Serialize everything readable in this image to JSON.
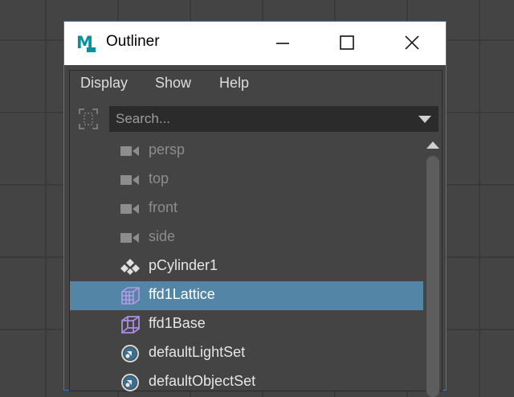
{
  "window": {
    "title": "Outliner",
    "app_icon_letter": "M",
    "border_color": "#1b7ee0"
  },
  "menu": {
    "items": [
      "Display",
      "Show",
      "Help"
    ]
  },
  "search": {
    "placeholder": "Search..."
  },
  "outliner": {
    "items": [
      {
        "label": "persp",
        "icon": "camera-icon",
        "dim": true
      },
      {
        "label": "top",
        "icon": "camera-icon",
        "dim": true
      },
      {
        "label": "front",
        "icon": "camera-icon",
        "dim": true
      },
      {
        "label": "side",
        "icon": "camera-icon",
        "dim": true
      },
      {
        "label": "pCylinder1",
        "icon": "transform-icon",
        "dim": false
      },
      {
        "label": "ffd1Lattice",
        "icon": "lattice-icon",
        "dim": false,
        "selected": true
      },
      {
        "label": "ffd1Base",
        "icon": "lattice-base-icon",
        "dim": false
      },
      {
        "label": "defaultLightSet",
        "icon": "set-icon",
        "dim": false
      },
      {
        "label": "defaultObjectSet",
        "icon": "set-icon",
        "dim": false
      }
    ]
  },
  "colors": {
    "selection": "#5285a6",
    "panel": "#444444",
    "search_bg": "#2b2b2b",
    "lattice": "#a98ee0"
  }
}
